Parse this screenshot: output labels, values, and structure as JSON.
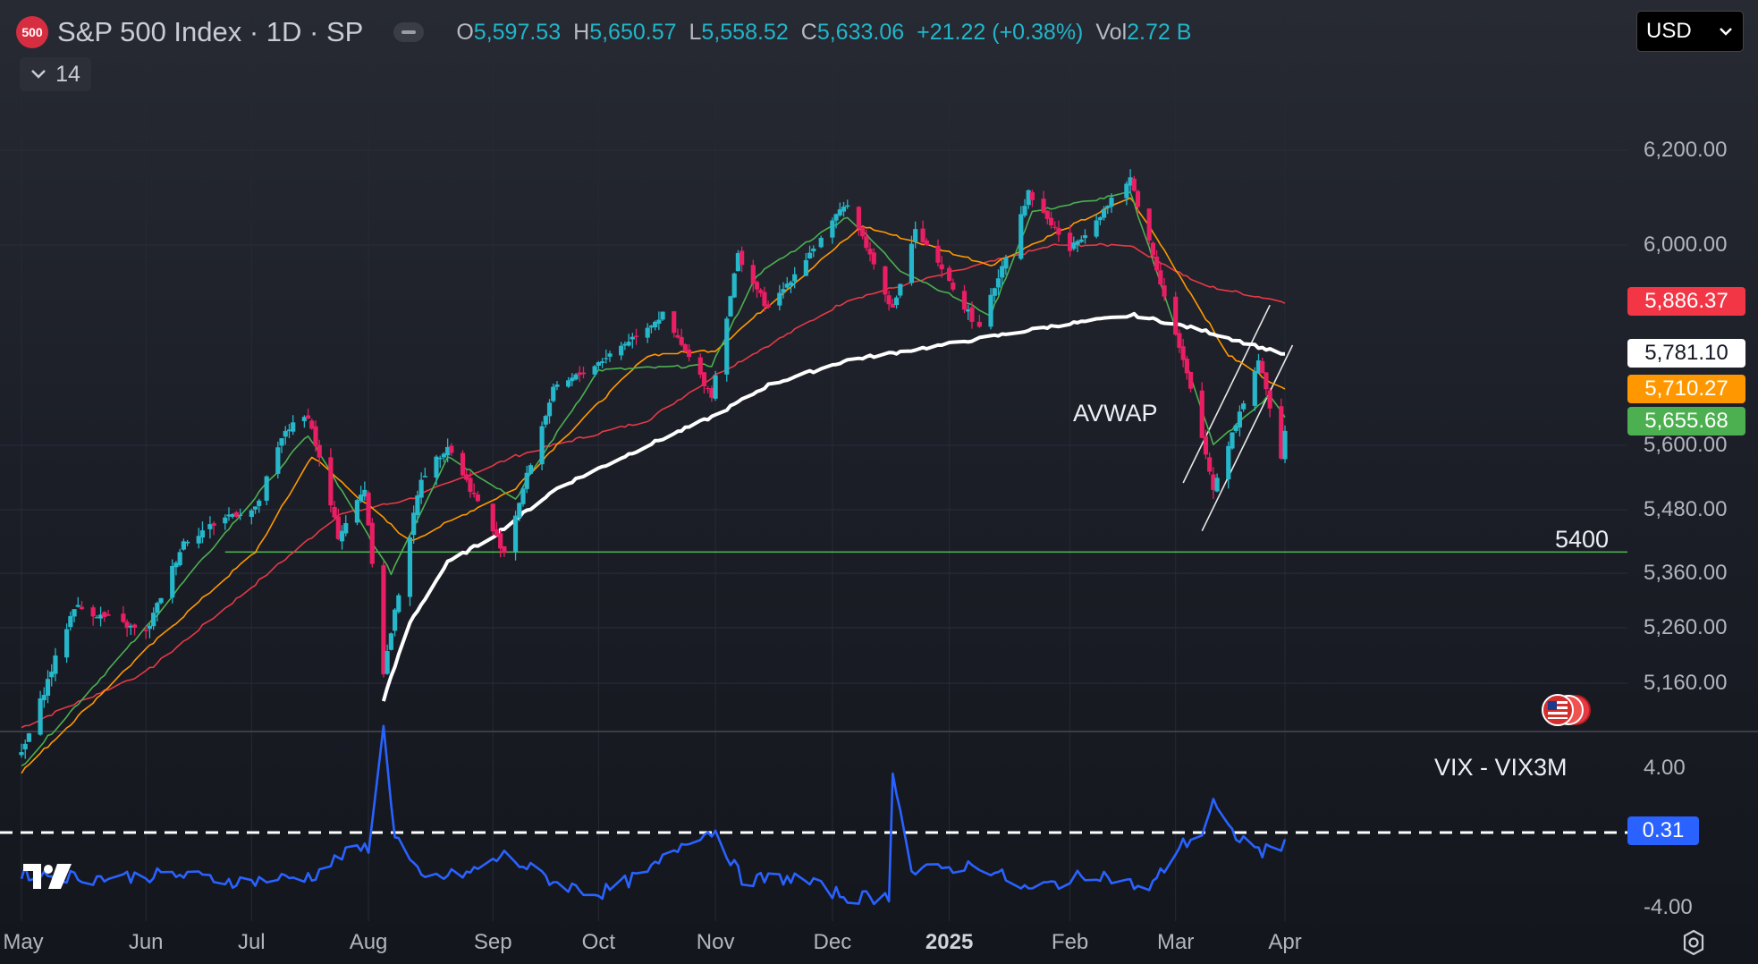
{
  "header": {
    "logo_text": "500",
    "symbol": "S&P 500 Index · 1D · SP",
    "ohlc": [
      {
        "key": "O",
        "value": "5,597.53"
      },
      {
        "key": "H",
        "value": "5,650.57"
      },
      {
        "key": "L",
        "value": "5,558.52"
      },
      {
        "key": "C",
        "value": "5,633.06"
      }
    ],
    "change": "+21.22 (+0.38%)",
    "vol_label": "Vol",
    "vol_value": "2.72 B",
    "collapse_count": "14",
    "currency": "USD"
  },
  "colors": {
    "up": "#26b7ca",
    "down": "#e91e63",
    "ma_fast": "#4caf50",
    "ma_mid": "#ff9800",
    "ma_slow": "#e53946",
    "avwap": "#ffffff",
    "support": "#4caf50",
    "vix": "#2962ff"
  },
  "annotations": {
    "avwap": "AVWAP",
    "support": "5400",
    "vix_title": "VIX - VIX3M"
  },
  "price_labels": [
    {
      "text": "5,886.37",
      "bg": "#f23645",
      "fg": "#ffffff",
      "value": 5886.37
    },
    {
      "text": "5,781.10",
      "bg": "#ffffff",
      "fg": "#131722",
      "value": 5781.1
    },
    {
      "text": "5,710.27",
      "bg": "#ff9800",
      "fg": "#ffffff",
      "value": 5710.27
    },
    {
      "text": "5,655.68",
      "bg": "#4caf50",
      "fg": "#ffffff",
      "value": 5655.68
    },
    {
      "text": "0.31",
      "bg": "#2962ff",
      "fg": "#ffffff",
      "value": 0.31
    }
  ],
  "chart_data": [
    {
      "type": "candlestick",
      "title": "S&P 500 Index · 1D · SP",
      "price_axis_ticks": [
        "6,200.00",
        "6,000.00",
        "5,600.00",
        "5,480.00",
        "5,360.00",
        "5,260.00",
        "5,160.00"
      ],
      "time_axis_ticks": [
        "May",
        "Jun",
        "Jul",
        "Aug",
        "Sep",
        "Oct",
        "Nov",
        "Dec",
        "2025",
        "Feb",
        "Mar",
        "Apr"
      ],
      "support_level": 5400,
      "anchors": {
        "close": [
          [
            "2024-05-01",
            5030
          ],
          [
            "2024-05-15",
            5300
          ],
          [
            "2024-06-03",
            5250
          ],
          [
            "2024-06-13",
            5420
          ],
          [
            "2024-06-25",
            5470
          ],
          [
            "2024-07-02",
            5480
          ],
          [
            "2024-07-10",
            5630
          ],
          [
            "2024-07-16",
            5660
          ],
          [
            "2024-07-24",
            5430
          ],
          [
            "2024-07-31",
            5520
          ],
          [
            "2024-08-05",
            5180
          ],
          [
            "2024-08-15",
            5540
          ],
          [
            "2024-08-22",
            5600
          ],
          [
            "2024-09-06",
            5400
          ],
          [
            "2024-09-19",
            5710
          ],
          [
            "2024-09-30",
            5760
          ],
          [
            "2024-10-18",
            5860
          ],
          [
            "2024-10-31",
            5700
          ],
          [
            "2024-11-07",
            5980
          ],
          [
            "2024-11-15",
            5870
          ],
          [
            "2024-12-06",
            6090
          ],
          [
            "2024-12-18",
            5870
          ],
          [
            "2024-12-24",
            6030
          ],
          [
            "2025-01-10",
            5830
          ],
          [
            "2025-01-23",
            6110
          ],
          [
            "2025-02-03",
            5990
          ],
          [
            "2025-02-19",
            6140
          ],
          [
            "2025-03-06",
            5740
          ],
          [
            "2025-03-13",
            5520
          ],
          [
            "2025-03-25",
            5770
          ],
          [
            "2025-03-31",
            5580
          ],
          [
            "2025-04-01",
            5633.06
          ]
        ],
        "ema_fast": [
          [
            "2024-05-01",
            5010
          ],
          [
            "2024-06-03",
            5260
          ],
          [
            "2024-07-16",
            5620
          ],
          [
            "2024-08-07",
            5360
          ],
          [
            "2024-08-22",
            5580
          ],
          [
            "2024-09-09",
            5500
          ],
          [
            "2024-10-01",
            5750
          ],
          [
            "2024-10-31",
            5760
          ],
          [
            "2024-11-12",
            5940
          ],
          [
            "2024-12-06",
            6060
          ],
          [
            "2024-12-20",
            5950
          ],
          [
            "2025-01-13",
            5860
          ],
          [
            "2025-01-24",
            6070
          ],
          [
            "2025-02-19",
            6110
          ],
          [
            "2025-03-13",
            5600
          ],
          [
            "2025-03-28",
            5700
          ],
          [
            "2025-04-01",
            5655.68
          ]
        ],
        "ema_mid": [
          [
            "2024-05-01",
            5000
          ],
          [
            "2024-06-03",
            5220
          ],
          [
            "2024-07-02",
            5400
          ],
          [
            "2024-07-17",
            5580
          ],
          [
            "2024-08-12",
            5420
          ],
          [
            "2024-09-09",
            5520
          ],
          [
            "2024-10-14",
            5780
          ],
          [
            "2024-11-01",
            5790
          ],
          [
            "2024-12-10",
            6040
          ],
          [
            "2025-01-13",
            5960
          ],
          [
            "2025-02-19",
            6100
          ],
          [
            "2025-03-17",
            5780
          ],
          [
            "2025-04-01",
            5710.27
          ]
        ],
        "ema_slow": [
          [
            "2024-05-01",
            5080
          ],
          [
            "2024-06-03",
            5180
          ],
          [
            "2024-07-02",
            5340
          ],
          [
            "2024-07-24",
            5470
          ],
          [
            "2024-08-12",
            5500
          ],
          [
            "2024-09-09",
            5580
          ],
          [
            "2024-10-14",
            5650
          ],
          [
            "2024-11-01",
            5740
          ],
          [
            "2024-12-06",
            5890
          ],
          [
            "2024-12-31",
            5940
          ],
          [
            "2025-01-30",
            6000
          ],
          [
            "2025-02-19",
            6000
          ],
          [
            "2025-03-10",
            5920
          ],
          [
            "2025-04-01",
            5886.37
          ]
        ],
        "avwap": [
          [
            "2024-08-05",
            5130
          ],
          [
            "2024-08-12",
            5270
          ],
          [
            "2024-08-22",
            5380
          ],
          [
            "2024-09-03",
            5430
          ],
          [
            "2024-09-20",
            5520
          ],
          [
            "2024-10-14",
            5600
          ],
          [
            "2024-11-01",
            5660
          ],
          [
            "2024-11-15",
            5720
          ],
          [
            "2024-12-06",
            5770
          ],
          [
            "2024-12-31",
            5800
          ],
          [
            "2025-01-31",
            5840
          ],
          [
            "2025-02-20",
            5860
          ],
          [
            "2025-03-10",
            5830
          ],
          [
            "2025-04-01",
            5781.1
          ]
        ]
      },
      "channel_lines": [
        {
          "start": [
            "2025-03-05",
            5530
          ],
          "end": [
            "2025-03-28",
            5880
          ]
        },
        {
          "start": [
            "2025-03-10",
            5440
          ],
          "end": [
            "2025-04-03",
            5800
          ]
        }
      ],
      "last_values": {
        "ema_slow": 5886.37,
        "avwap": 5781.1,
        "ema_mid": 5710.27,
        "ema_fast": 5655.68
      }
    },
    {
      "type": "line",
      "title": "VIX - VIX3M",
      "ylim_ticks": [
        "4.00",
        "-4.00"
      ],
      "reference_value": 0.31,
      "anchors": [
        [
          "2024-05-01",
          -2.0
        ],
        [
          "2024-05-20",
          -2.3
        ],
        [
          "2024-06-10",
          -2.1
        ],
        [
          "2024-06-28",
          -2.5
        ],
        [
          "2024-07-17",
          -2.2
        ],
        [
          "2024-07-25",
          -1.0
        ],
        [
          "2024-08-01",
          -0.5
        ],
        [
          "2024-08-05",
          6.2
        ],
        [
          "2024-08-08",
          0.2
        ],
        [
          "2024-08-15",
          -2.4
        ],
        [
          "2024-08-28",
          -2.0
        ],
        [
          "2024-09-06",
          -1.0
        ],
        [
          "2024-09-20",
          -2.6
        ],
        [
          "2024-10-01",
          -3.2
        ],
        [
          "2024-10-14",
          -2.0
        ],
        [
          "2024-10-25",
          0.0
        ],
        [
          "2024-11-01",
          0.4
        ],
        [
          "2024-11-08",
          -2.4
        ],
        [
          "2024-11-22",
          -2.3
        ],
        [
          "2024-12-06",
          -3.4
        ],
        [
          "2024-12-17",
          -3.4
        ],
        [
          "2024-12-18",
          4.0
        ],
        [
          "2024-12-23",
          -2.0
        ],
        [
          "2025-01-10",
          -1.5
        ],
        [
          "2025-01-23",
          -3.0
        ],
        [
          "2025-02-10",
          -2.0
        ],
        [
          "2025-02-24",
          -3.0
        ],
        [
          "2025-03-04",
          -0.5
        ],
        [
          "2025-03-10",
          0.3
        ],
        [
          "2025-03-13",
          2.0
        ],
        [
          "2025-03-17",
          0.4
        ],
        [
          "2025-03-26",
          -0.8
        ],
        [
          "2025-03-31",
          -0.5
        ],
        [
          "2025-04-01",
          0.31
        ]
      ]
    }
  ]
}
